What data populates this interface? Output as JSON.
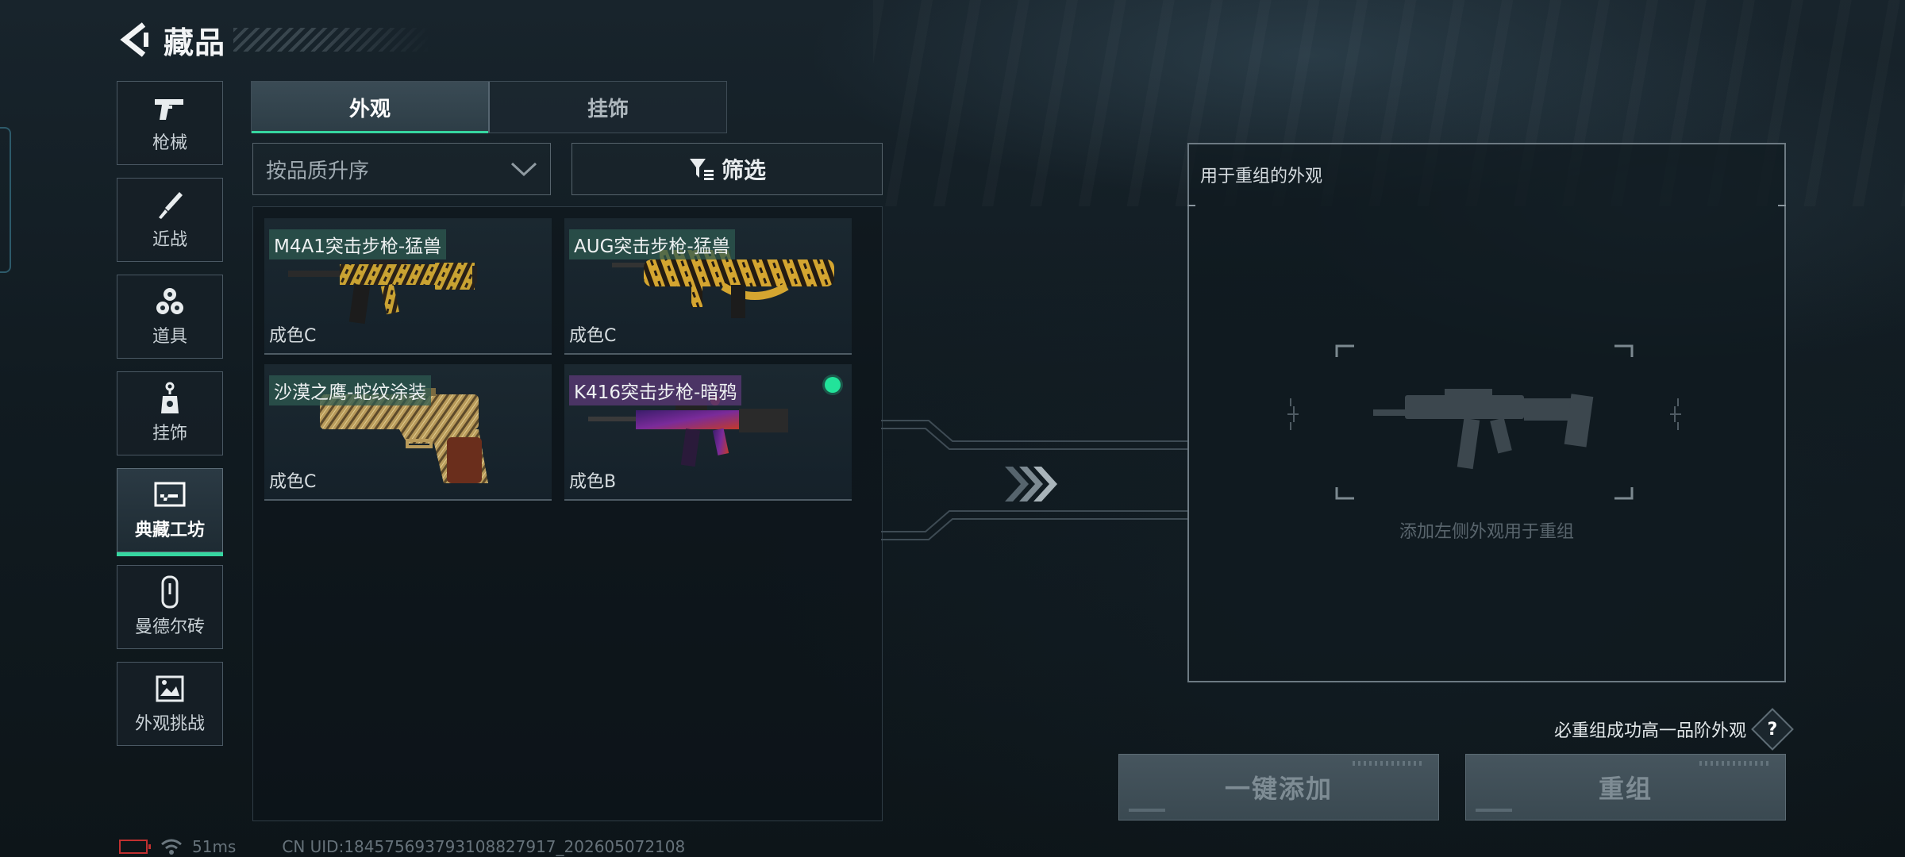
{
  "header": {
    "title": "藏品",
    "back_icon": "back-arrow-icon"
  },
  "sidebar": {
    "items": [
      {
        "label": "枪械",
        "icon": "pistol-icon",
        "active": false
      },
      {
        "label": "近战",
        "icon": "knife-icon",
        "active": false
      },
      {
        "label": "道具",
        "icon": "grenades-icon",
        "active": false
      },
      {
        "label": "挂饰",
        "icon": "charm-icon",
        "active": false
      },
      {
        "label": "典藏工坊",
        "icon": "workshop-icon",
        "active": true
      },
      {
        "label": "曼德尔砖",
        "icon": "mandel-brick-icon",
        "active": false
      },
      {
        "label": "外观挑战",
        "icon": "challenge-image-icon",
        "active": false
      }
    ],
    "active_color": "#36d6a0"
  },
  "tabs": [
    {
      "label": "外观",
      "active": true
    },
    {
      "label": "挂饰",
      "active": false
    }
  ],
  "sort": {
    "value": "按品质升序"
  },
  "filter": {
    "label": "筛选",
    "icon": "filter-icon"
  },
  "items": [
    {
      "name": "M4A1突击步枪-猛兽",
      "condition": "成色C",
      "tag_color": "#2d5a50",
      "equipped": false
    },
    {
      "name": "AUG突击步枪-猛兽",
      "condition": "成色C",
      "tag_color": "#2d5a50",
      "equipped": false
    },
    {
      "name": "沙漠之鹰-蛇纹涂装",
      "condition": "成色C",
      "tag_color": "#2d5a50",
      "equipped": false
    },
    {
      "name": "K416突击步枪-暗鸦",
      "condition": "成色B",
      "tag_color": "#553770",
      "equipped": true
    }
  ],
  "equipped_color": "#22e39a",
  "recombine_panel": {
    "title": "用于重组的外观",
    "hint": "添加左侧外观用于重组"
  },
  "note": {
    "text": "必重组成功高一品阶外观",
    "help_label": "?"
  },
  "buttons": {
    "add_all": "一键添加",
    "recombine": "重组"
  },
  "status_bar": {
    "ping": "51ms",
    "uid": "CN UID:18457569379310882791​7_202605072108"
  }
}
